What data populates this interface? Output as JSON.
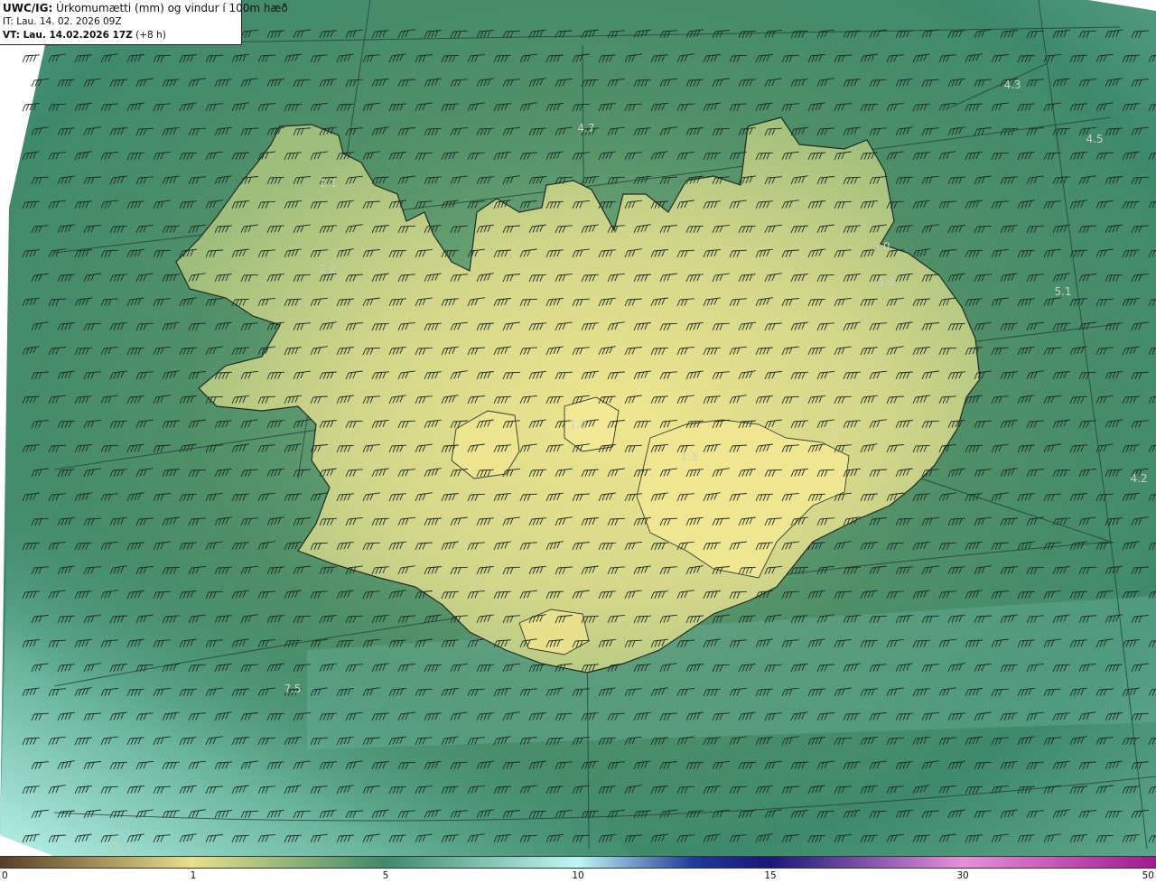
{
  "header": {
    "model": "UWC/IG:",
    "title": "Úrkomumætti (mm) og vindur í 100m hæð",
    "issue_time": "IT: Lau. 14. 02. 2026 09Z",
    "valid_time_bold": "VT: Lau. 14.02.2026 17Z",
    "valid_time_offset": "(+8 h)"
  },
  "map_values": [
    {
      "text": "4.3"
    },
    {
      "text": "4.5"
    },
    {
      "text": "4.7"
    },
    {
      "text": "2.1"
    },
    {
      "text": "2.2"
    },
    {
      "text": "5.0"
    },
    {
      "text": "4.9"
    },
    {
      "text": "5.1"
    },
    {
      "text": "4.2"
    },
    {
      "text": "1.0"
    },
    {
      "text": "1.3"
    },
    {
      "text": "7.5"
    },
    {
      "text": "10.4"
    }
  ],
  "legend": {
    "ticks": [
      "0",
      "1",
      "5",
      "10",
      "15",
      "30",
      "50"
    ],
    "colors": {
      "dry": "#5a3e28",
      "low": "#e8e08a",
      "mid": "#3f8a6a",
      "high": "#bff7f4",
      "very_high": "#203a9a",
      "extreme": "#1a1678",
      "top": "#e890d8",
      "max": "#a01890"
    }
  }
}
